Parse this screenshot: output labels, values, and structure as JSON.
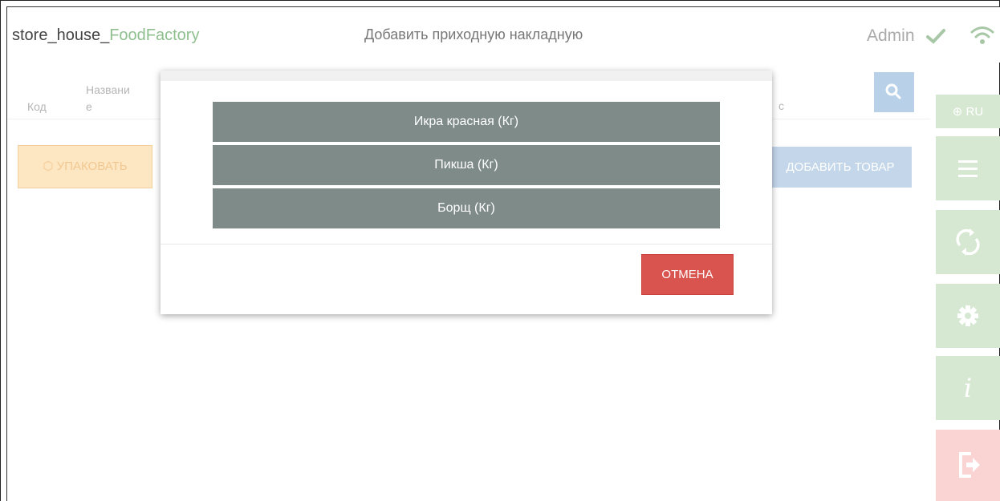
{
  "header": {
    "brand_prefix": "store_house_",
    "brand_accent": "FoodFactory",
    "title": "Добавить приходную накладную",
    "user": "Admin",
    "icons": [
      "check-icon",
      "wifi-icon"
    ]
  },
  "table": {
    "col_code": "Код",
    "col_name_1": "Названи",
    "col_name_2": "е",
    "col_partial": "с"
  },
  "toolbar": {
    "pack_label": "УПАКОВАТЬ",
    "add_label": "ДОБАВИТЬ ТОВАР"
  },
  "sidebar": {
    "lang_label": "RU",
    "icons": [
      "globe-icon",
      "menu-icon",
      "sync-icon",
      "gear-icon",
      "info-icon",
      "logout-icon"
    ],
    "info_glyph": "i"
  },
  "modal": {
    "products": [
      "Икра красная  (Кг)",
      "Пикша  (Кг)",
      "Борщ  (Кг)"
    ],
    "cancel_label": "ОТМЕНА"
  },
  "colors": {
    "accent_green": "#8fbf8f",
    "product_button": "#7e8b88",
    "cancel_red": "#d9534f",
    "search_blue": "#b8d0e8",
    "pack_orange": "#fde6c2",
    "logout_pink": "#fad3d3"
  }
}
